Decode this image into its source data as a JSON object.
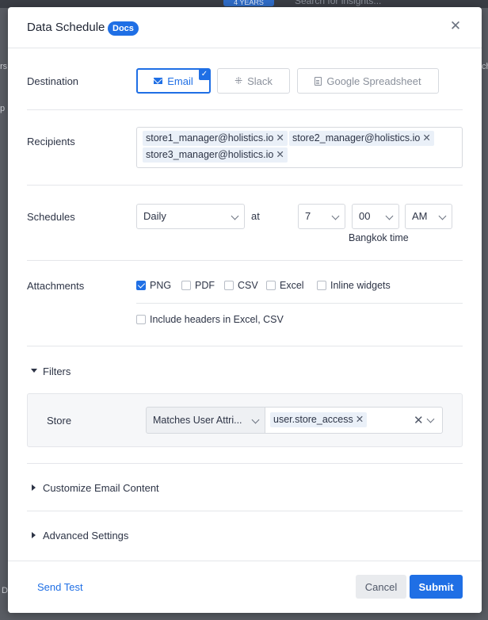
{
  "background": {
    "pill": "4 YEARS",
    "search_placeholder": "Search for insights...",
    "fragments": [
      "rs",
      "p",
      "ch",
      "D"
    ]
  },
  "modal": {
    "title": "Data Schedule",
    "docs_badge": "Docs",
    "close_icon": "close-icon"
  },
  "destination": {
    "label": "Destination",
    "options": [
      {
        "label": "Email",
        "icon": "mail-icon",
        "selected": true
      },
      {
        "label": "Slack",
        "icon": "slack-icon",
        "selected": false
      },
      {
        "label": "Google Spreadsheet",
        "icon": "spreadsheet-icon",
        "selected": false
      }
    ]
  },
  "recipients": {
    "label": "Recipients",
    "tags": [
      "store1_manager@holistics.io",
      "store2_manager@holistics.io",
      "store3_manager@holistics.io"
    ]
  },
  "schedules": {
    "label": "Schedules",
    "frequency": "Daily",
    "at_label": "at",
    "hour": "7",
    "minute": "00",
    "period": "AM",
    "timezone": "Bangkok time"
  },
  "attachments": {
    "label": "Attachments",
    "options": [
      {
        "label": "PNG",
        "checked": true
      },
      {
        "label": "PDF",
        "checked": false
      },
      {
        "label": "CSV",
        "checked": false
      },
      {
        "label": "Excel",
        "checked": false
      },
      {
        "label": "Inline widgets",
        "checked": false
      }
    ],
    "include_headers": {
      "label": "Include headers in Excel, CSV",
      "checked": false
    }
  },
  "filters": {
    "title": "Filters",
    "expanded": true,
    "rows": [
      {
        "field": "Store",
        "condition": "Matches User Attri...",
        "value_tag": "user.store_access"
      }
    ]
  },
  "sections": {
    "customize_email": "Customize Email Content",
    "advanced_settings": "Advanced Settings"
  },
  "footer": {
    "send_test": "Send Test",
    "cancel": "Cancel",
    "submit": "Submit"
  },
  "colors": {
    "accent": "#1f6fe5",
    "tag_bg": "#eaf0f8",
    "border": "#d6d9de"
  }
}
